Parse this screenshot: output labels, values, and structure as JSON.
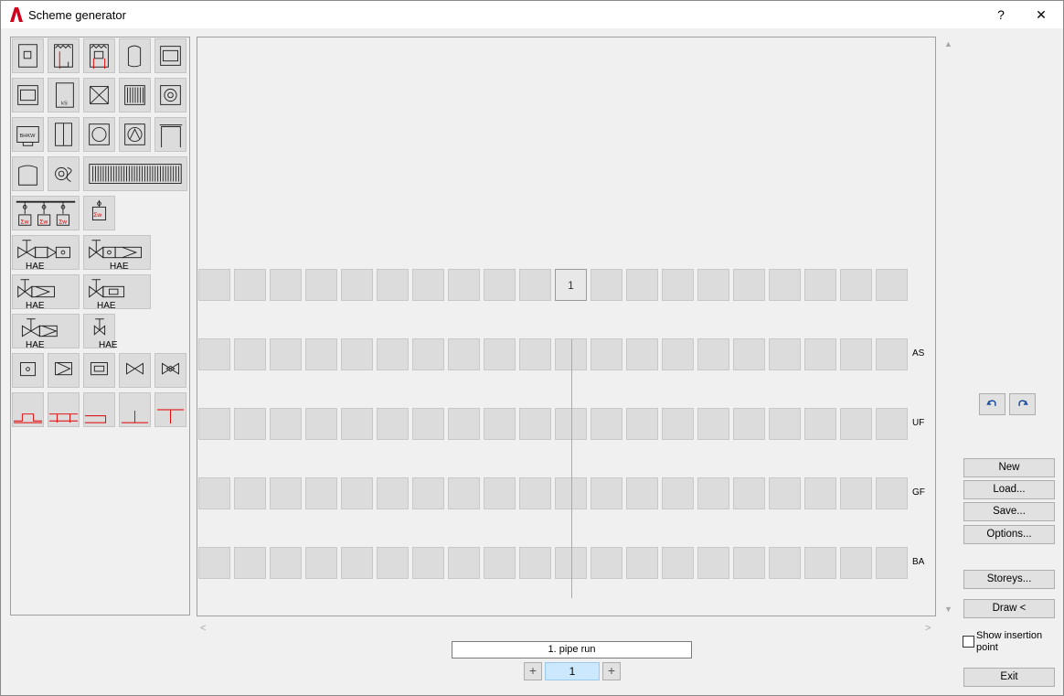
{
  "window": {
    "title": "Scheme generator",
    "help_label": "?",
    "close_label": "✕"
  },
  "palette": {
    "hae_label": "HAE",
    "items": [
      "boiler-icon",
      "boiler-with-pipes-icon",
      "boiler-with-heater-icon",
      "storage-tank-icon",
      "oven-icon",
      "oven-2-icon",
      "kw-unit-icon",
      "heat-exchanger-icon",
      "radiator-icon",
      "fan-unit-icon",
      "chp-unit-icon",
      "panel-unit-icon",
      "pump-circle-icon",
      "pump-2-icon",
      "frame-unit-icon",
      "tank-icon",
      "pump-with-pipe-icon",
      "long-radiator-icon",
      "consumer-group-icon",
      "consumer-single-icon",
      "valve-assembly-1-icon",
      "valve-assembly-2-icon",
      "valve-assembly-3-icon",
      "valve-assembly-4-icon",
      "valve-assembly-5-icon",
      "valve-single-icon",
      "meter-icon",
      "cone-valve-icon",
      "flow-meter-icon",
      "butterfly-valve-icon",
      "butterfly-valve-2-icon",
      "pipe-tee-1-icon",
      "pipe-tee-2-icon",
      "pipe-tee-3-icon",
      "pipe-tee-4-icon",
      "pipe-tee-5-icon"
    ]
  },
  "canvas": {
    "top_row_active_label": "1",
    "storey_labels": [
      "AS",
      "UF",
      "GF",
      "BA"
    ]
  },
  "pipe_run": {
    "value": "1. pipe run",
    "stepper_value": "1",
    "plus_label": "+"
  },
  "commands": {
    "new": "New",
    "load": "Load...",
    "save": "Save...",
    "options": "Options...",
    "storeys": "Storeys...",
    "draw": "Draw <",
    "exit": "Exit"
  },
  "show_insertion_point": {
    "label": "Show insertion point",
    "checked": false
  },
  "colors": {
    "accent_red": "#e00000",
    "pipe_line": "#f0a800",
    "stepper_bg": "#cce8ff"
  }
}
